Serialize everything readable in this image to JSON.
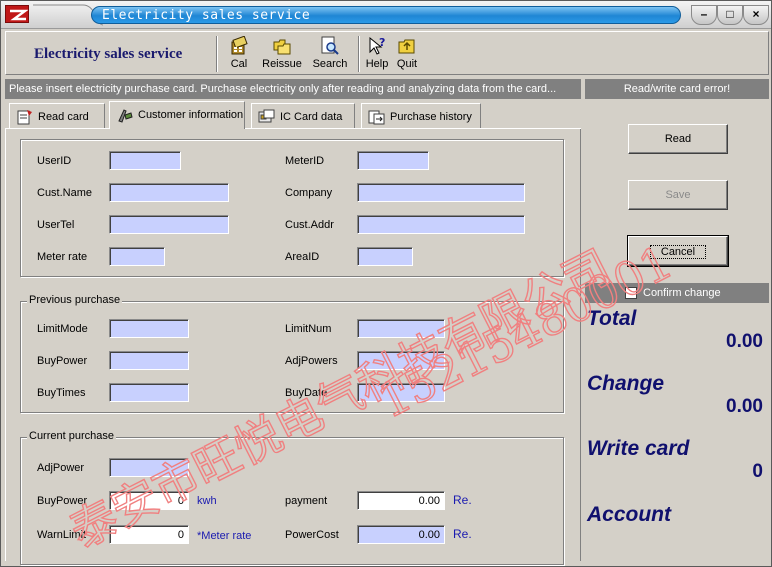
{
  "window": {
    "title": "Electricity sales service"
  },
  "toolbar": {
    "app_title": "Electricity sales service",
    "buttons": [
      "Cal",
      "Reissue",
      "Search",
      "Help",
      "Quit"
    ]
  },
  "status": {
    "message": "Please insert electricity purchase card. Purchase electricity only after reading and analyzing data from the card...",
    "card_error": "Read/write card error!"
  },
  "tabs": [
    "Read card",
    "Customer information",
    "IC Card data",
    "Purchase history"
  ],
  "customer": {
    "userid": "UserID",
    "meterid": "MeterID",
    "custname": "Cust.Name",
    "company": "Company",
    "usertel": "UserTel",
    "custaddr": "Cust.Addr",
    "meterrate": "Meter rate",
    "areaid": "AreaID"
  },
  "previous": {
    "caption": "Previous purchase",
    "limitmode": "LimitMode",
    "limitnum": "LimitNum",
    "buypower": "BuyPower",
    "adjpowers": "AdjPowers",
    "buytimes": "BuyTimes",
    "buydate": "BuyDate"
  },
  "current": {
    "caption": "Current purchase",
    "adjpower": "AdjPower",
    "buypower": "BuyPower",
    "buypower_value": "0",
    "buypower_unit": "kwh",
    "payment": "payment",
    "payment_value": "0.00",
    "payment_unit": "Re.",
    "warnlimit": "WarnLimit",
    "warnlimit_value": "0",
    "warnlimit_unit": "*Meter rate",
    "powercost": "PowerCost",
    "powercost_value": "0.00",
    "powercost_unit": "Re."
  },
  "side": {
    "read": "Read",
    "save": "Save",
    "cancel": "Cancel",
    "confirm_change": "Confirm change",
    "total_label": "Total",
    "total_value": "0.00",
    "change_label": "Change",
    "change_value": "0.00",
    "writecard_label": "Write card",
    "writecard_value": "0",
    "account_label": "Account"
  },
  "watermark": {
    "company": "泰安市旺悦电气科技有限公司",
    "phone": "15215480001"
  },
  "colors": {
    "field_bg": "#c8d0fe",
    "label_blue": "#10106e",
    "title_blue": "#1f86d4",
    "watermark": "#f08080"
  }
}
